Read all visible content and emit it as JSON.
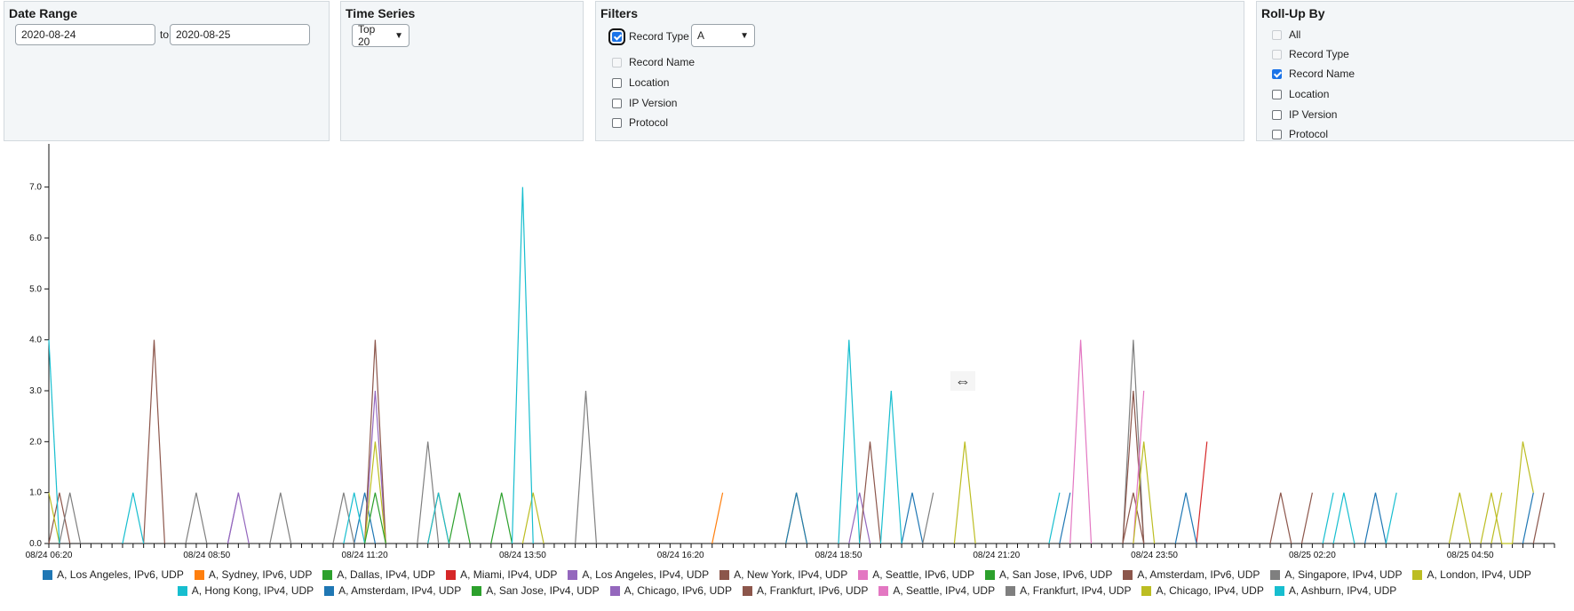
{
  "date_range": {
    "title": "Date Range",
    "from": "2020-08-24",
    "to_label": "to",
    "to": "2020-08-25"
  },
  "time_series": {
    "title": "Time Series",
    "selected": "Top 20"
  },
  "filters": {
    "title": "Filters",
    "record_type_label": "Record Type",
    "record_type_value": "A",
    "items": [
      "Record Name",
      "Location",
      "IP Version",
      "Protocol"
    ]
  },
  "rollup": {
    "title": "Roll-Up By",
    "items": [
      "All",
      "Record Type",
      "Record Name",
      "Location",
      "IP Version",
      "Protocol"
    ]
  },
  "chart_data": {
    "type": "line",
    "title": "",
    "xlabel": "",
    "ylabel": "",
    "ylim": [
      0,
      7.5
    ],
    "xlim": [
      "08/24 06:20",
      "08/25 05:50"
    ],
    "yticks": [
      "0.0",
      "1.0",
      "2.0",
      "3.0",
      "4.0",
      "5.0",
      "6.0",
      "7.0"
    ],
    "xticks": [
      "08/24 06:20",
      "08/24 08:50",
      "08/24 11:20",
      "08/24 13:50",
      "08/24 16:20",
      "08/24 18:50",
      "08/24 21:20",
      "08/24 23:50",
      "08/25 02:20",
      "08/25 04:50"
    ],
    "series": [
      {
        "name": "A, Los Angeles, IPv6, UDP",
        "color": "#1f77b4",
        "points": [
          [
            "08/24 11:10",
            0
          ],
          [
            "08/24 11:20",
            1
          ],
          [
            "08/24 11:30",
            0
          ],
          [
            "08/24 19:50",
            0
          ],
          [
            "08/24 20:00",
            1
          ],
          [
            "08/24 20:10",
            0
          ],
          [
            "08/25 03:10",
            0
          ],
          [
            "08/25 03:20",
            1
          ],
          [
            "08/25 03:30",
            0
          ]
        ]
      },
      {
        "name": "A, Sydney, IPv6, UDP",
        "color": "#ff7f0e",
        "points": [
          [
            "08/24 12:20",
            0
          ],
          [
            "08/24 12:30",
            1
          ],
          [
            "08/24 12:40",
            0
          ],
          [
            "08/24 16:50",
            0
          ],
          [
            "08/24 17:00",
            1
          ]
        ]
      },
      {
        "name": "A, Dallas, IPv4, UDP",
        "color": "#2ca02c",
        "points": [
          [
            "08/24 12:40",
            0
          ],
          [
            "08/24 12:50",
            1
          ],
          [
            "08/24 13:00",
            0
          ]
        ]
      },
      {
        "name": "A, Miami, IPv4, UDP",
        "color": "#d62728",
        "points": [
          [
            "08/25 00:30",
            0
          ],
          [
            "08/25 00:40",
            2
          ]
        ]
      },
      {
        "name": "A, Los Angeles, IPv4, UDP",
        "color": "#9467bd",
        "points": [
          [
            "08/24 09:10",
            0
          ],
          [
            "08/24 09:20",
            1
          ],
          [
            "08/24 09:30",
            0
          ],
          [
            "08/24 11:20",
            0
          ],
          [
            "08/24 11:30",
            3
          ],
          [
            "08/24 11:40",
            0
          ],
          [
            "08/24 19:00",
            0
          ],
          [
            "08/24 19:10",
            1
          ],
          [
            "08/24 19:20",
            0
          ]
        ]
      },
      {
        "name": "A, New York, IPv4, UDP",
        "color": "#8c564b",
        "points": [
          [
            "08/24 07:50",
            0
          ],
          [
            "08/24 08:00",
            4
          ],
          [
            "08/24 08:10",
            0
          ],
          [
            "08/24 11:20",
            0
          ],
          [
            "08/24 11:30",
            4
          ],
          [
            "08/24 11:40",
            0
          ],
          [
            "08/24 19:10",
            0
          ],
          [
            "08/24 19:20",
            2
          ],
          [
            "08/24 19:30",
            0
          ],
          [
            "08/24 23:20",
            0
          ],
          [
            "08/24 23:30",
            1
          ],
          [
            "08/24 23:40",
            0
          ],
          [
            "08/25 02:10",
            0
          ],
          [
            "08/25 02:20",
            1
          ],
          [
            "08/25 05:50",
            0
          ],
          [
            "08/25 06:00",
            1
          ]
        ]
      },
      {
        "name": "A, Seattle, IPv6, UDP",
        "color": "#e377c2",
        "points": [
          [
            "08/24 22:30",
            0
          ],
          [
            "08/24 22:40",
            4
          ],
          [
            "08/24 22:50",
            0
          ]
        ]
      },
      {
        "name": "A, San Jose, IPv6, UDP",
        "color": "#2ca02c",
        "points": [
          [
            "08/24 13:20",
            0
          ],
          [
            "08/24 13:30",
            1
          ],
          [
            "08/24 13:40",
            0
          ]
        ]
      },
      {
        "name": "A, Amsterdam, IPv6, UDP",
        "color": "#8c564b",
        "points": [
          [
            "08/24 06:20",
            0
          ],
          [
            "08/24 06:30",
            1
          ],
          [
            "08/24 06:40",
            0
          ],
          [
            "08/25 01:40",
            0
          ],
          [
            "08/25 01:50",
            1
          ],
          [
            "08/25 02:00",
            0
          ]
        ]
      },
      {
        "name": "A, Singapore, IPv4, UDP",
        "color": "#7f7f7f",
        "points": [
          [
            "08/24 08:30",
            0
          ],
          [
            "08/24 08:40",
            1
          ],
          [
            "08/24 08:50",
            0
          ],
          [
            "08/24 09:50",
            0
          ],
          [
            "08/24 10:00",
            1
          ],
          [
            "08/24 10:10",
            0
          ],
          [
            "08/24 10:50",
            0
          ],
          [
            "08/24 11:00",
            1
          ],
          [
            "08/24 11:10",
            0
          ],
          [
            "08/24 12:10",
            0
          ],
          [
            "08/24 12:20",
            2
          ],
          [
            "08/24 12:30",
            0
          ],
          [
            "08/24 14:40",
            0
          ],
          [
            "08/24 14:50",
            3
          ],
          [
            "08/24 15:00",
            0
          ],
          [
            "08/24 20:10",
            0
          ],
          [
            "08/24 20:20",
            1
          ],
          [
            "08/24 23:20",
            0
          ],
          [
            "08/24 23:30",
            4
          ],
          [
            "08/24 23:40",
            0
          ]
        ]
      },
      {
        "name": "A, London, IPv4, UDP",
        "color": "#bcbd22",
        "points": [
          [
            "08/24 06:20",
            1
          ],
          [
            "08/24 06:30",
            0
          ],
          [
            "08/24 11:20",
            0
          ],
          [
            "08/24 11:30",
            2
          ],
          [
            "08/24 11:40",
            0
          ],
          [
            "08/24 13:50",
            0
          ],
          [
            "08/24 14:00",
            1
          ],
          [
            "08/24 14:10",
            0
          ],
          [
            "08/24 18:00",
            0
          ],
          [
            "08/24 18:10",
            1
          ],
          [
            "08/24 18:20",
            0
          ],
          [
            "08/24 20:40",
            0
          ],
          [
            "08/24 20:50",
            2
          ],
          [
            "08/24 21:00",
            0
          ],
          [
            "08/25 04:30",
            0
          ],
          [
            "08/25 04:40",
            1
          ],
          [
            "08/25 04:50",
            0
          ],
          [
            "08/25 05:10",
            0
          ],
          [
            "08/25 05:20",
            1
          ]
        ]
      },
      {
        "name": "A, Hong Kong, IPv4, UDP",
        "color": "#17becf",
        "points": [
          [
            "08/24 07:30",
            0
          ],
          [
            "08/24 07:40",
            1
          ],
          [
            "08/24 07:50",
            0
          ],
          [
            "08/24 11:00",
            0
          ],
          [
            "08/24 11:10",
            1
          ],
          [
            "08/24 11:20",
            0
          ],
          [
            "08/24 13:40",
            0
          ],
          [
            "08/24 13:50",
            7
          ],
          [
            "08/24 14:00",
            0
          ],
          [
            "08/24 18:50",
            0
          ],
          [
            "08/24 19:00",
            4
          ],
          [
            "08/24 19:10",
            0
          ],
          [
            "08/24 19:30",
            0
          ],
          [
            "08/24 19:40",
            3
          ],
          [
            "08/24 19:50",
            0
          ],
          [
            "08/24 22:10",
            0
          ],
          [
            "08/24 22:20",
            1
          ],
          [
            "08/25 02:30",
            0
          ],
          [
            "08/25 02:40",
            1
          ],
          [
            "08/25 03:30",
            0
          ],
          [
            "08/25 03:40",
            1
          ]
        ]
      },
      {
        "name": "A, Amsterdam, IPv4, UDP",
        "color": "#1f77b4",
        "points": [
          [
            "08/24 18:00",
            0
          ],
          [
            "08/24 18:10",
            1
          ],
          [
            "08/24 18:20",
            0
          ],
          [
            "08/24 22:20",
            0
          ],
          [
            "08/24 22:30",
            1
          ],
          [
            "08/25 00:10",
            0
          ],
          [
            "08/25 00:20",
            1
          ],
          [
            "08/25 00:30",
            0
          ],
          [
            "08/25 05:40",
            0
          ],
          [
            "08/25 05:50",
            1
          ]
        ]
      },
      {
        "name": "A, San Jose, IPv4, UDP",
        "color": "#2ca02c",
        "points": [
          [
            "08/24 11:20",
            0
          ],
          [
            "08/24 11:30",
            1
          ],
          [
            "08/24 11:40",
            0
          ]
        ]
      },
      {
        "name": "A, Chicago, IPv6, UDP",
        "color": "#9467bd",
        "points": [
          [
            "08/24 09:10",
            0
          ],
          [
            "08/24 09:20",
            1
          ]
        ]
      },
      {
        "name": "A, Frankfurt, IPv6, UDP",
        "color": "#8c564b",
        "points": [
          [
            "08/24 23:20",
            0
          ],
          [
            "08/24 23:30",
            3
          ],
          [
            "08/24 23:40",
            0
          ]
        ]
      },
      {
        "name": "A, Seattle, IPv4, UDP",
        "color": "#e377c2",
        "points": [
          [
            "08/24 23:30",
            0
          ],
          [
            "08/24 23:40",
            3
          ]
        ]
      },
      {
        "name": "A, Frankfurt, IPv4, UDP",
        "color": "#7f7f7f",
        "points": [
          [
            "08/24 06:30",
            0
          ],
          [
            "08/24 06:40",
            1
          ],
          [
            "08/24 06:50",
            0
          ]
        ]
      },
      {
        "name": "A, Chicago, IPv4, UDP",
        "color": "#bcbd22",
        "points": [
          [
            "08/24 23:30",
            0
          ],
          [
            "08/24 23:40",
            2
          ],
          [
            "08/24 23:50",
            0
          ],
          [
            "08/25 05:00",
            0
          ],
          [
            "08/25 05:10",
            1
          ],
          [
            "08/25 05:20",
            0
          ],
          [
            "08/25 05:30",
            0
          ],
          [
            "08/25 05:40",
            2
          ],
          [
            "08/25 05:50",
            1
          ]
        ]
      },
      {
        "name": "A, Ashburn, IPv4, UDP",
        "color": "#17becf",
        "points": [
          [
            "08/24 06:20",
            4
          ],
          [
            "08/24 06:30",
            0
          ],
          [
            "08/24 12:20",
            0
          ],
          [
            "08/24 12:30",
            1
          ],
          [
            "08/24 12:40",
            0
          ],
          [
            "08/25 02:40",
            0
          ],
          [
            "08/25 02:50",
            1
          ],
          [
            "08/25 03:00",
            0
          ]
        ]
      }
    ]
  }
}
